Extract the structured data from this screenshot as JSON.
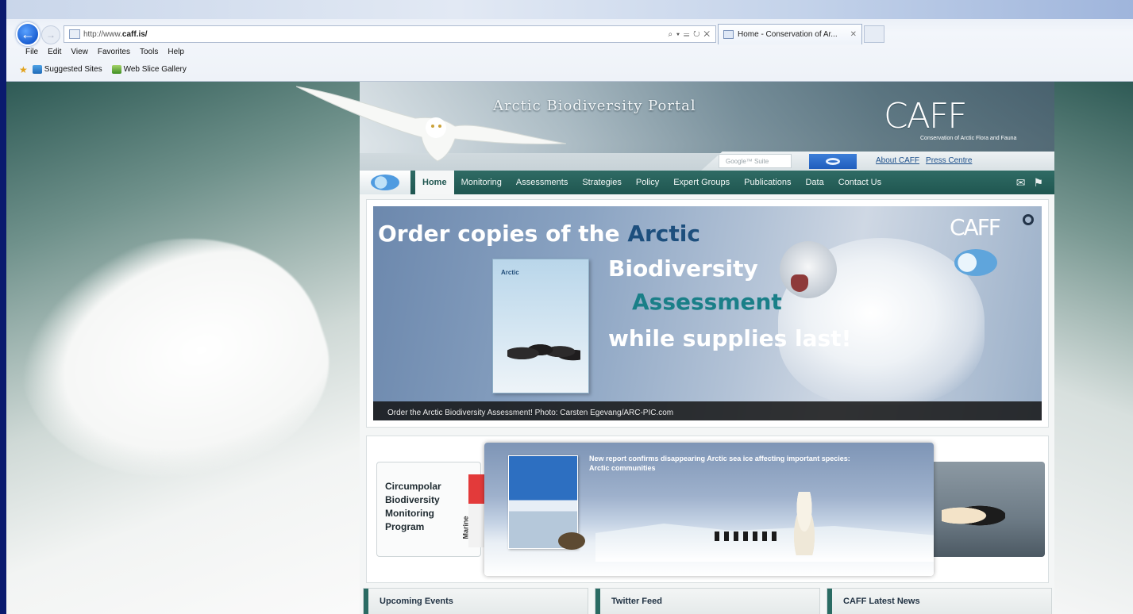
{
  "browser": {
    "address_url_prefix": "http://www.",
    "address_url_domain": "caff.is/",
    "address_tools": "⌕ ▾ ☰ ↻ ✕",
    "tab_title": "Home - Conservation of Ar...",
    "tab_close": "✕",
    "back_icon": "←",
    "forward_icon": "→",
    "menu": [
      "File",
      "Edit",
      "View",
      "Favorites",
      "Tools",
      "Help"
    ],
    "favorites": [
      "Suggested Sites",
      "Web Slice Gallery"
    ]
  },
  "site": {
    "portal_title": "Arctic Biodiversity Portal",
    "caff_logo": "CAFF",
    "caff_subtitle": "Conservation of Arctic Flora and Fauna",
    "search_placeholder": "Google™ Suite",
    "top_links": [
      "About CAFF",
      "Press Centre"
    ],
    "nav": [
      "Home",
      "Monitoring",
      "Assessments",
      "Strategies",
      "Policy",
      "Expert Groups",
      "Publications",
      "Data",
      "Contact Us"
    ],
    "nav_active_index": 0
  },
  "banner": {
    "line1_prefix": "Order copies of the ",
    "line1_highlight": "Arctic",
    "line2": "Biodiversity",
    "line3": "Assessment",
    "line4": "while supplies last!",
    "book_title": "Arctic",
    "banner_logo": "CAFF",
    "caption": "Order the Arctic Biodiversity Assessment! Photo: Carsten Egevang/ARC-PIC.com"
  },
  "slider": {
    "left_card": [
      "Circumpolar",
      "Biodiversity",
      "Monitoring",
      "Program"
    ],
    "left_strip_label": "Marine",
    "news_title": "New report confirms disappearing Arctic sea ice affecting important species: Arctic communities"
  },
  "bottom_boxes": [
    "Upcoming Events",
    "Twitter Feed",
    "CAFF Latest News"
  ],
  "colors": {
    "nav_bg": "#1f5650",
    "accent": "#2a6b63",
    "link": "#1c4f8b",
    "frame": "#1a2fa0"
  }
}
